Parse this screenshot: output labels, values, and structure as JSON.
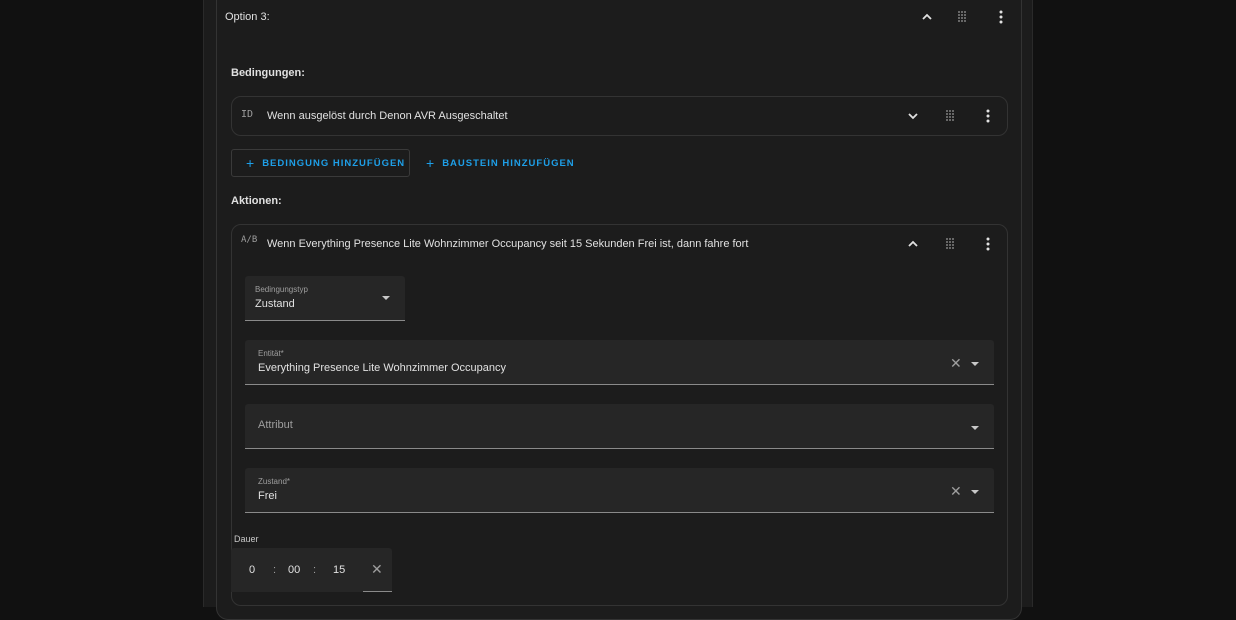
{
  "option": {
    "title": "Option 3:"
  },
  "conditions": {
    "label": "Bedingungen:",
    "item": {
      "type_icon": "ID",
      "text": "Wenn ausgelöst durch Denon AVR Ausgeschaltet"
    },
    "add_condition_label": "BEDINGUNG HINZUFÜGEN",
    "add_block_label": "BAUSTEIN HINZUFÜGEN"
  },
  "actions": {
    "label": "Aktionen:",
    "item": {
      "type_icon": "A/B",
      "text": "Wenn Everything Presence Lite Wohnzimmer Occupancy seit 15 Sekunden Frei ist, dann fahre fort"
    }
  },
  "form": {
    "condition_type": {
      "label": "Bedingungstyp",
      "value": "Zustand"
    },
    "entity": {
      "label": "Entität*",
      "value": "Everything Presence Lite Wohnzimmer Occupancy"
    },
    "attribute": {
      "placeholder": "Attribut"
    },
    "state": {
      "label": "Zustand*",
      "value": "Frei"
    },
    "duration": {
      "label": "Dauer",
      "hours": "0",
      "minutes": "00",
      "seconds": "15",
      "separator": ":"
    }
  },
  "icons": {
    "collapse": "chevron-up-icon",
    "expand": "chevron-down-icon",
    "drag": "drag-handle-icon",
    "menu": "dots-vertical-icon",
    "clear": "close-icon"
  },
  "colors": {
    "accent": "#1e9fe8",
    "background": "#111111",
    "panel": "#1c1c1c",
    "field": "#262626"
  }
}
